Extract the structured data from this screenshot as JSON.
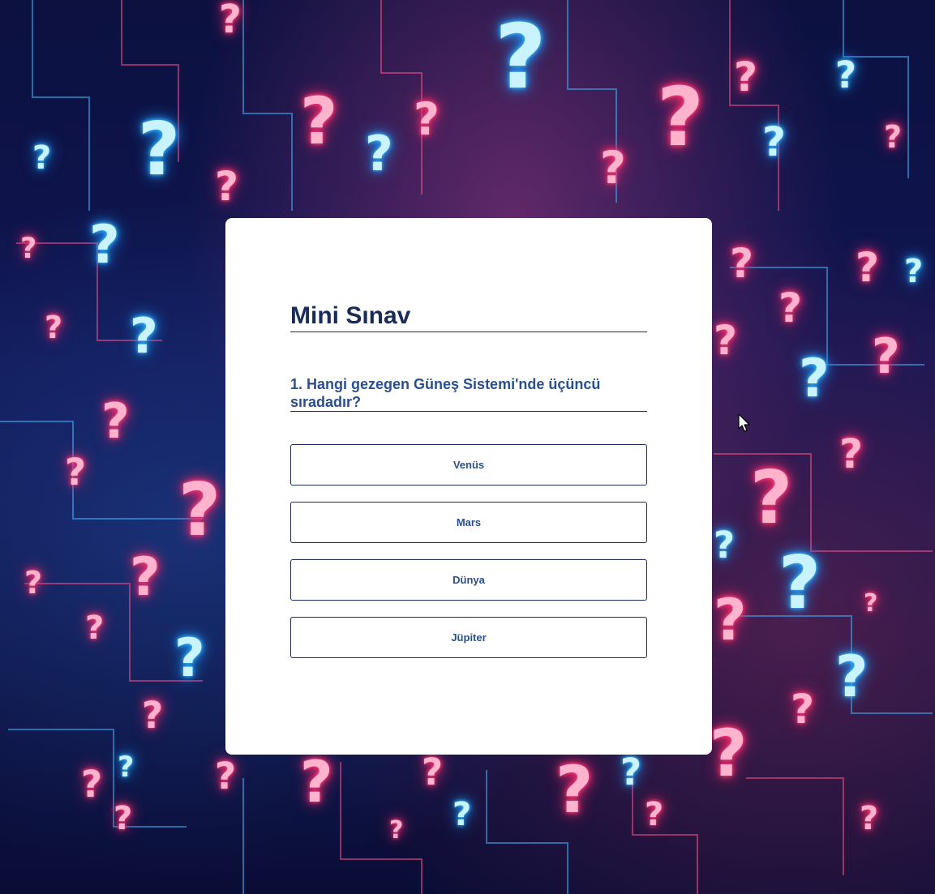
{
  "quiz": {
    "title": "Mini Sınav",
    "question": "1. Hangi gezegen Güneş Sistemi'nde üçüncü sıradadır?",
    "options": [
      "Venüs",
      "Mars",
      "Dünya",
      "Jüpiter"
    ]
  },
  "colors": {
    "title": "#1a2b5a",
    "question": "#2a4f8f",
    "option_text": "#2a4f8f",
    "border": "#1a2b5a",
    "card": "#ffffff",
    "neon_pink": "#ff2a6d",
    "neon_blue": "#1e9cff"
  },
  "background": {
    "icon": "question-mark-icon"
  }
}
